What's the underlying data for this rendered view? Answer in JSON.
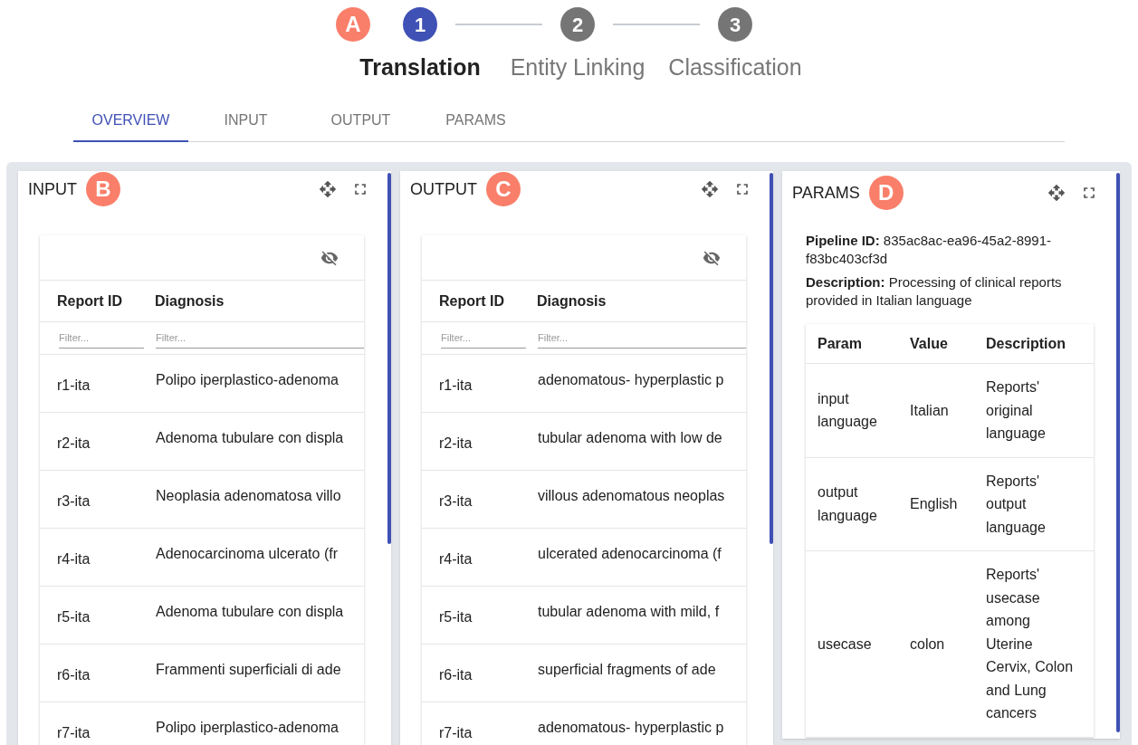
{
  "stepper": {
    "marker": "A",
    "steps": [
      {
        "number": "1",
        "label": "Translation",
        "selected": true
      },
      {
        "number": "2",
        "label": "Entity Linking",
        "selected": false
      },
      {
        "number": "3",
        "label": "Classification",
        "selected": false
      }
    ]
  },
  "tabs": [
    {
      "label": "OVERVIEW",
      "selected": true
    },
    {
      "label": "INPUT",
      "selected": false
    },
    {
      "label": "OUTPUT",
      "selected": false
    },
    {
      "label": "PARAMS",
      "selected": false
    }
  ],
  "panels": [
    {
      "kind": "table",
      "title": "INPUT",
      "marker": "B",
      "columns": [
        "Report ID",
        "Diagnosis"
      ],
      "filters": [
        {
          "placeholder": "Filter..."
        },
        {
          "placeholder": "Filter..."
        }
      ],
      "rows": [
        [
          "r1-ita",
          "Polipo iperplastico-adenoma"
        ],
        [
          "r2-ita",
          "Adenoma tubulare con displa"
        ],
        [
          "r3-ita",
          "Neoplasia adenomatosa villo"
        ],
        [
          "r4-ita",
          "Adenocarcinoma ulcerato (fr"
        ],
        [
          "r5-ita",
          "Adenoma tubulare con displa"
        ],
        [
          "r6-ita",
          "Frammenti superficiali di ade"
        ],
        [
          "r7-ita",
          "Polipo iperplastico-adenoma"
        ]
      ]
    },
    {
      "kind": "table",
      "title": "OUTPUT",
      "marker": "C",
      "columns": [
        "Report ID",
        "Diagnosis"
      ],
      "filters": [
        {
          "placeholder": "Filter..."
        },
        {
          "placeholder": "Filter..."
        }
      ],
      "rows": [
        [
          "r1-ita",
          "adenomatous- hyperplastic p"
        ],
        [
          "r2-ita",
          "tubular adenoma with low de"
        ],
        [
          "r3-ita",
          "villous adenomatous neoplas"
        ],
        [
          "r4-ita",
          "ulcerated adenocarcinoma (f"
        ],
        [
          "r5-ita",
          "tubular adenoma with mild, f"
        ],
        [
          "r6-ita",
          "superficial fragments of ade"
        ],
        [
          "r7-ita",
          "adenomatous- hyperplastic p"
        ]
      ]
    },
    {
      "kind": "params",
      "title": "PARAMS",
      "marker": "D",
      "info": [
        "**Pipeline ID:** 835ac8ac-ea96-45a2-8991-f83bc403cf3d",
        "**Description:** Processing of clinical reports provided in Italian language"
      ],
      "columns": [
        "Param",
        "Value",
        "Description"
      ],
      "rows": [
        [
          "input language",
          "Italian",
          "Reports' original language"
        ],
        [
          "output language",
          "English",
          "Reports' output language"
        ],
        [
          "usecase",
          "colon",
          "Reports' usecase among Uterine Cervix, Colon and Lung cancers"
        ]
      ]
    }
  ]
}
